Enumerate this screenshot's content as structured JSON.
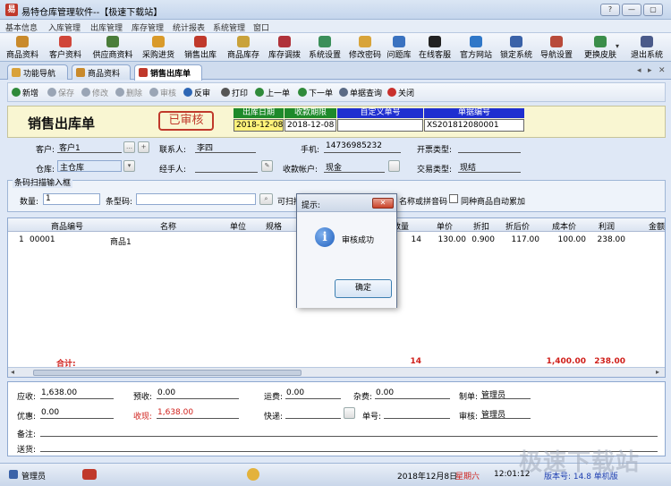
{
  "window": {
    "title": "易特仓库管理软件--【极速下载站】",
    "icon_char": "易",
    "buttons": [
      "?",
      "—",
      "▢",
      "✕"
    ]
  },
  "menu": [
    "基本信息",
    "入库管理",
    "出库管理",
    "库存管理",
    "统计报表",
    "系统管理",
    "窗口"
  ],
  "toolbar": [
    {
      "label": "商品资料",
      "icon": "box-icon",
      "color": "#c98a2b"
    },
    {
      "label": "客户资料",
      "icon": "user-icon",
      "color": "#d0463a"
    },
    {
      "label": "供应商资料",
      "icon": "supplier-icon",
      "color": "#4a7d3a"
    },
    {
      "label": "采购进货",
      "icon": "truck-icon",
      "color": "#d99a2a"
    },
    {
      "label": "销售出库",
      "icon": "cart-icon",
      "color": "#c0392b"
    },
    {
      "label": "商品库存",
      "icon": "stock-icon",
      "color": "#c9a23a"
    },
    {
      "label": "库存调拨",
      "icon": "transfer-icon",
      "color": "#b0323a"
    },
    {
      "label": "系统设置",
      "icon": "settings-icon",
      "color": "#3b8f5a"
    },
    {
      "label": "修改密码",
      "icon": "key-icon",
      "color": "#d8a43a"
    },
    {
      "label": "问题库",
      "icon": "question-icon",
      "color": "#3a72c0"
    },
    {
      "label": "在线客服",
      "icon": "qq-icon",
      "color": "#222222"
    },
    {
      "label": "官方网站",
      "icon": "ie-icon",
      "color": "#2f77c8"
    },
    {
      "label": "锁定系统",
      "icon": "lock-icon",
      "color": "#3a62a8"
    },
    {
      "label": "导航设置",
      "icon": "nav-icon",
      "color": "#b84a3a"
    },
    {
      "label": "更换皮肤",
      "icon": "skin-icon",
      "color": "#3b8e4a"
    },
    {
      "label": "退出系统",
      "icon": "exit-icon",
      "color": "#4a5a8a"
    }
  ],
  "tabs": [
    {
      "label": "功能导航",
      "color": "#d9a23a",
      "active": false
    },
    {
      "label": "商品资料",
      "color": "#c98a2b",
      "active": false
    },
    {
      "label": "销售出库单",
      "color": "#c0392b",
      "active": true
    }
  ],
  "tab_nav": [
    "◂",
    "▸",
    "✕"
  ],
  "actions": [
    {
      "label": "新增",
      "color": "#2f8a3a",
      "disabled": false
    },
    {
      "label": "保存",
      "color": "#9aa5b5",
      "disabled": true
    },
    {
      "label": "修改",
      "color": "#9aa5b5",
      "disabled": true
    },
    {
      "label": "删除",
      "color": "#9aa5b5",
      "disabled": true
    },
    {
      "label": "审核",
      "color": "#9aa5b5",
      "disabled": true
    },
    {
      "label": "反审",
      "color": "#2d66b5",
      "disabled": false
    },
    {
      "label": "打印",
      "color": "#555555",
      "disabled": false
    },
    {
      "label": "上一单",
      "color": "#2f8a3a",
      "disabled": false
    },
    {
      "label": "下一单",
      "color": "#2f8a3a",
      "disabled": false
    },
    {
      "label": "单据查询",
      "color": "#5a6a85",
      "disabled": false
    },
    {
      "label": "关闭",
      "color": "#c9302c",
      "disabled": false
    }
  ],
  "header": {
    "form_title": "销售出库单",
    "status_stamp": "已审核",
    "columns": [
      {
        "label": "出库日期",
        "value": "2018-12-08",
        "head_color": "#1e8a2a",
        "highlight": true
      },
      {
        "label": "收款期限",
        "value": "2018-12-08",
        "head_color": "#1e8a2a",
        "highlight": false
      },
      {
        "label": "自定义单号",
        "value": "",
        "head_color": "#1f2fd0",
        "highlight": false
      },
      {
        "label": "单据编号",
        "value": "XS201812080001",
        "head_color": "#1f2fd0",
        "highlight": false
      }
    ]
  },
  "info": {
    "customer_label": "客户:",
    "customer": "客户1",
    "contact_label": "联系人:",
    "contact": "李四",
    "phone_label": "手机:",
    "phone": "14736985232",
    "invoice_label": "开票类型:",
    "invoice": "",
    "warehouse_label": "仓库:",
    "warehouse": "主仓库",
    "handler_label": "经手人:",
    "handler": "",
    "account_label": "收款帐户:",
    "account": "现金",
    "trade_label": "交易类型:",
    "trade": "现结"
  },
  "barcode": {
    "section_title": "条码扫描输入框",
    "qty_label": "数量:",
    "qty": "1",
    "code_label": "条型码:",
    "code": "",
    "scan_hint": "可扫描",
    "name_hint": "名称或拼音码",
    "auto_sum_label": "同种商品自动累加"
  },
  "grid": {
    "headers": [
      "商品编号",
      "名称",
      "单位",
      "规格",
      "数量",
      "单价",
      "折扣",
      "折后价",
      "成本价",
      "利润",
      "金额"
    ],
    "rows": [
      {
        "idx": "1",
        "code": "00001",
        "name": "商品1",
        "qty": "14",
        "price": "130.00",
        "discount": "0.900",
        "net_price": "117.00",
        "cost": "100.00",
        "profit": "238.00"
      }
    ],
    "total_label": "合计:",
    "total_qty": "14",
    "total_cost": "1,400.00",
    "total_profit": "238.00"
  },
  "footer": {
    "receivable_label": "应收:",
    "receivable": "1,638.00",
    "prepaid_label": "预收:",
    "prepaid": "0.00",
    "freight_label": "运费:",
    "freight": "0.00",
    "misc_label": "杂费:",
    "misc": "0.00",
    "maker_label": "制单:",
    "maker": "管理员",
    "discount_label": "优惠:",
    "discount": "0.00",
    "received_label": "收现:",
    "received": "1,638.00",
    "express_label": "快递:",
    "express": "",
    "tracking_label": "单号:",
    "tracking": "",
    "auditor_label": "审核:",
    "auditor": "管理员",
    "remark_label": "备注:",
    "remark": "",
    "delivery_label": "送货:",
    "delivery": ""
  },
  "statusbar": {
    "user": "管理员",
    "date": "2018年12月8日",
    "weekday": "星期六",
    "time": "12:01:12",
    "version": "版本号: 14.8 单机版"
  },
  "dialog": {
    "title": "提示:",
    "close": "✕",
    "message": "审核成功",
    "ok_label": "确定",
    "icon_char": "i"
  },
  "watermark": "极速下载站"
}
